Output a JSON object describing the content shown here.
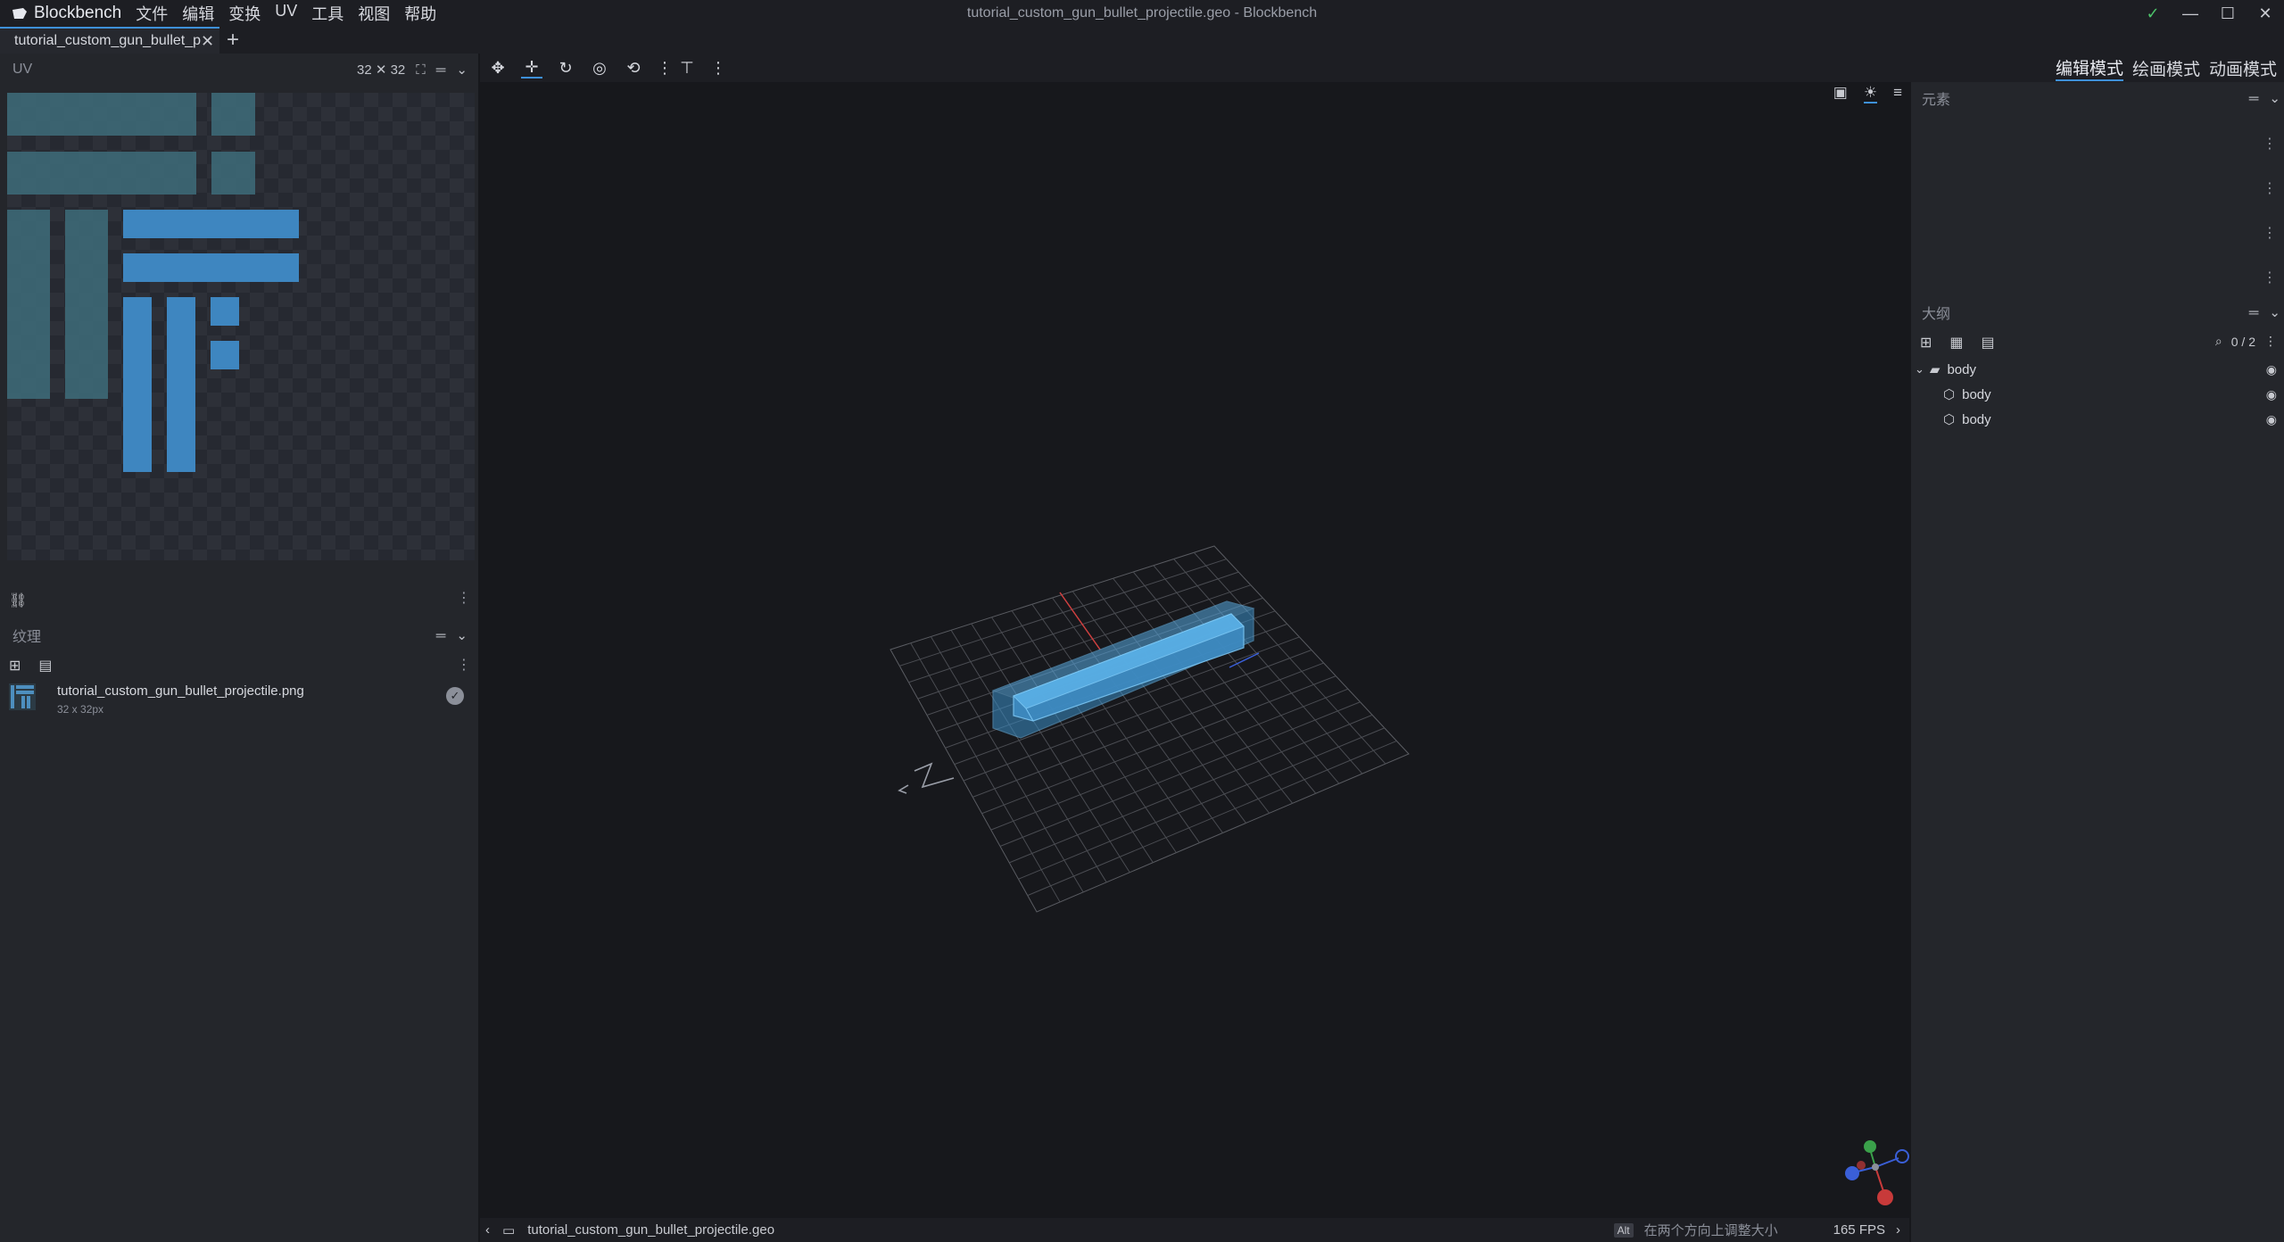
{
  "app": {
    "name": "Blockbench",
    "window_title": "tutorial_custom_gun_bullet_projectile.geo - Blockbench",
    "menu": [
      "文件",
      "编辑",
      "变换",
      "UV",
      "工具",
      "视图",
      "帮助"
    ],
    "window_controls": {
      "check": "✓",
      "minimize": "—",
      "maximize": "☐",
      "close": "✕"
    }
  },
  "tabs": {
    "active_label": "tutorial_custom_gun_bullet_p",
    "close": "✕",
    "add": "+"
  },
  "uv_panel": {
    "title": "UV",
    "size_label": "32 ✕ 32",
    "link_icon": "link-icon"
  },
  "texture_panel": {
    "title": "纹理",
    "file_name": "tutorial_custom_gun_bullet_projectile.png",
    "file_size": "32 x 32px"
  },
  "toolbar": {
    "tools": [
      "move-handles-icon",
      "move-icon",
      "rotate-icon",
      "pivot-icon",
      "vertex-snap-icon",
      "mirror-icon"
    ],
    "modes": [
      "编辑模式",
      "绘画模式",
      "动画模式"
    ],
    "active_mode": "编辑模式"
  },
  "elements_panel": {
    "title": "元素"
  },
  "outline_panel": {
    "title": "大纲",
    "count": "0 / 2",
    "tree": [
      {
        "label": "body",
        "type": "group"
      },
      {
        "label": "body",
        "type": "cube"
      },
      {
        "label": "body",
        "type": "cube"
      }
    ]
  },
  "status": {
    "file": "tutorial_custom_gun_bullet_projectile.geo",
    "key": "Alt",
    "hint": "在两个方向上调整大小",
    "fps": "165 FPS"
  },
  "colors": {
    "accent": "#3e90d8",
    "panel": "#24262b",
    "viewport": "#17181c",
    "cube": "#5aaee8"
  }
}
